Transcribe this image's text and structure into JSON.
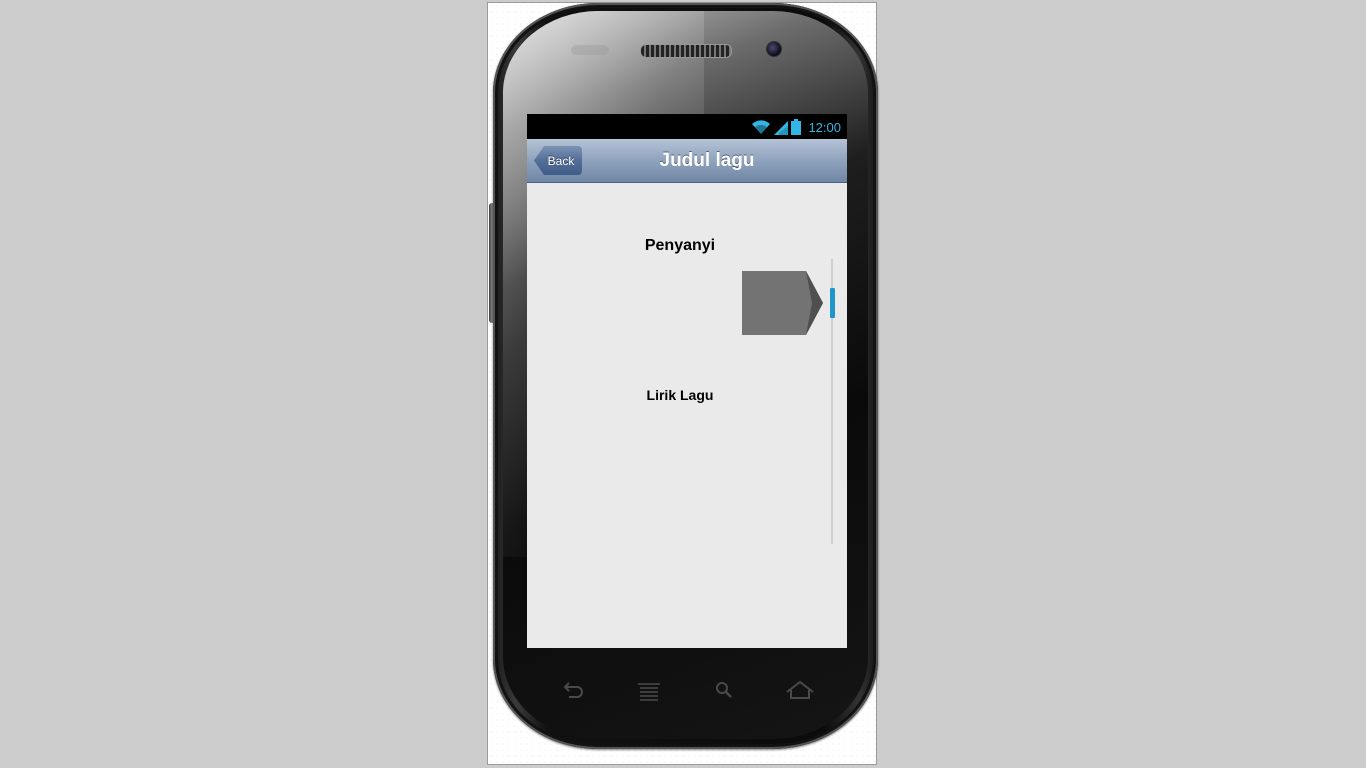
{
  "status_bar": {
    "time": "12:00",
    "icons": [
      "wifi-icon",
      "signal-icon",
      "battery-icon"
    ],
    "accent_color": "#33b5e5"
  },
  "header": {
    "back_label": "Back",
    "title": "Judul lagu"
  },
  "content": {
    "singer_label": "Penyanyi",
    "lyrics_label": "Lirik Lagu",
    "shape_color": "#737373",
    "scroll_thumb_color": "#2196c8"
  },
  "softkeys": [
    "back-icon",
    "menu-icon",
    "search-icon",
    "home-icon"
  ]
}
